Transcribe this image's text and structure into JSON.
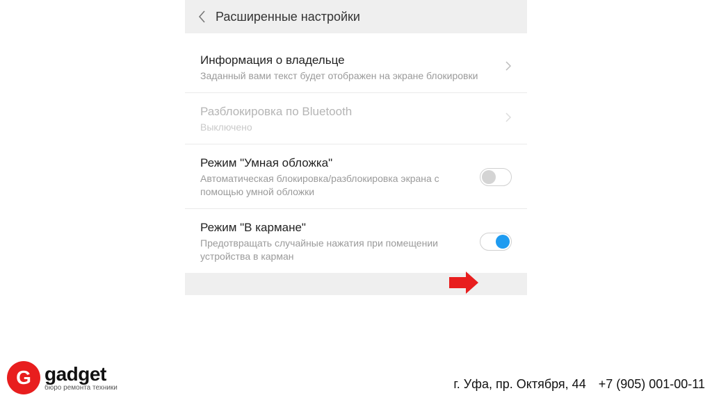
{
  "header": {
    "title": "Расширенные настройки"
  },
  "items": [
    {
      "title": "Информация о владельце",
      "sub": "Заданный вами текст будет отображен на экране блокировки",
      "trailing": "chevron",
      "disabled": false
    },
    {
      "title": "Разблокировка по Bluetooth",
      "sub": "Выключено",
      "trailing": "chevron",
      "disabled": true
    },
    {
      "title": "Режим \"Умная обложка\"",
      "sub": "Автоматическая блокировка/разблокировка экрана с помощью умной обложки",
      "trailing": "toggle",
      "on": false,
      "disabled": false
    },
    {
      "title": "Режим \"В кармане\"",
      "sub": "Предотвращать случайные нажатия при помещении устройства в карман",
      "trailing": "toggle",
      "on": true,
      "disabled": false
    }
  ],
  "logo": {
    "letter": "G",
    "name": "gadget",
    "tagline": "бюро ремонта техники"
  },
  "contact": {
    "address": "г. Уфа, пр. Октября, 44",
    "phone": "+7 (905) 001-00-11"
  }
}
